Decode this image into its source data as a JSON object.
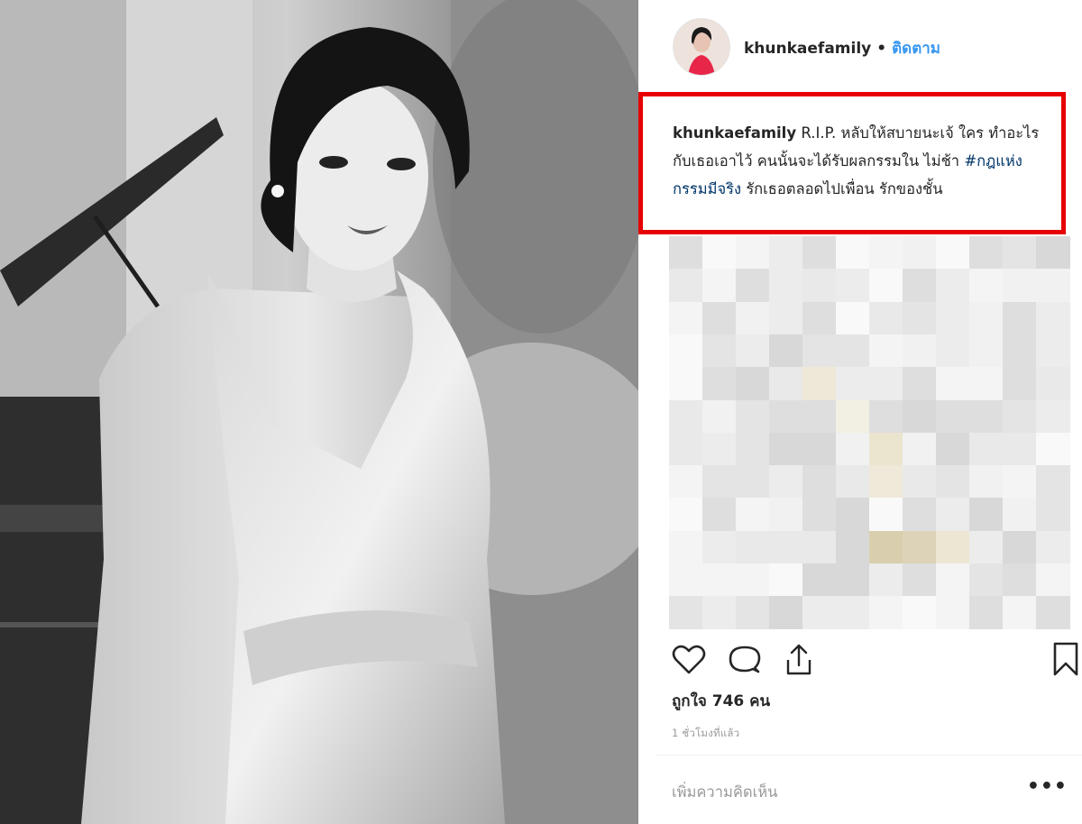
{
  "post": {
    "username": "khunkaefamily",
    "follow_label": "ติดตาม",
    "caption_text_1": "R.I.P. หลับให้สบายนะเจ้ ใคร ทำอะไรกับเธอเอาไว้ คนนั้นจะได้รับผลกรรมใน ไม่ช้า",
    "hashtag": "#กฎแห่งกรรมมีจริง",
    "caption_text_2": "รักเธอตลอดไปเพื่อน รักของชั้น",
    "likes": "ถูกใจ 746 คน",
    "timestamp": "1 ชั่วโมงที่แล้ว",
    "comment_placeholder": "เพิ่มความคิดเห็น",
    "more_label": "•••"
  },
  "icons": [
    "heart-icon",
    "comment-icon",
    "share-icon",
    "bookmark-icon"
  ],
  "colors": {
    "highlight_border": "#e60000",
    "link": "#3897f0",
    "hashtag": "#003569",
    "text": "#262626",
    "muted": "#999999"
  }
}
